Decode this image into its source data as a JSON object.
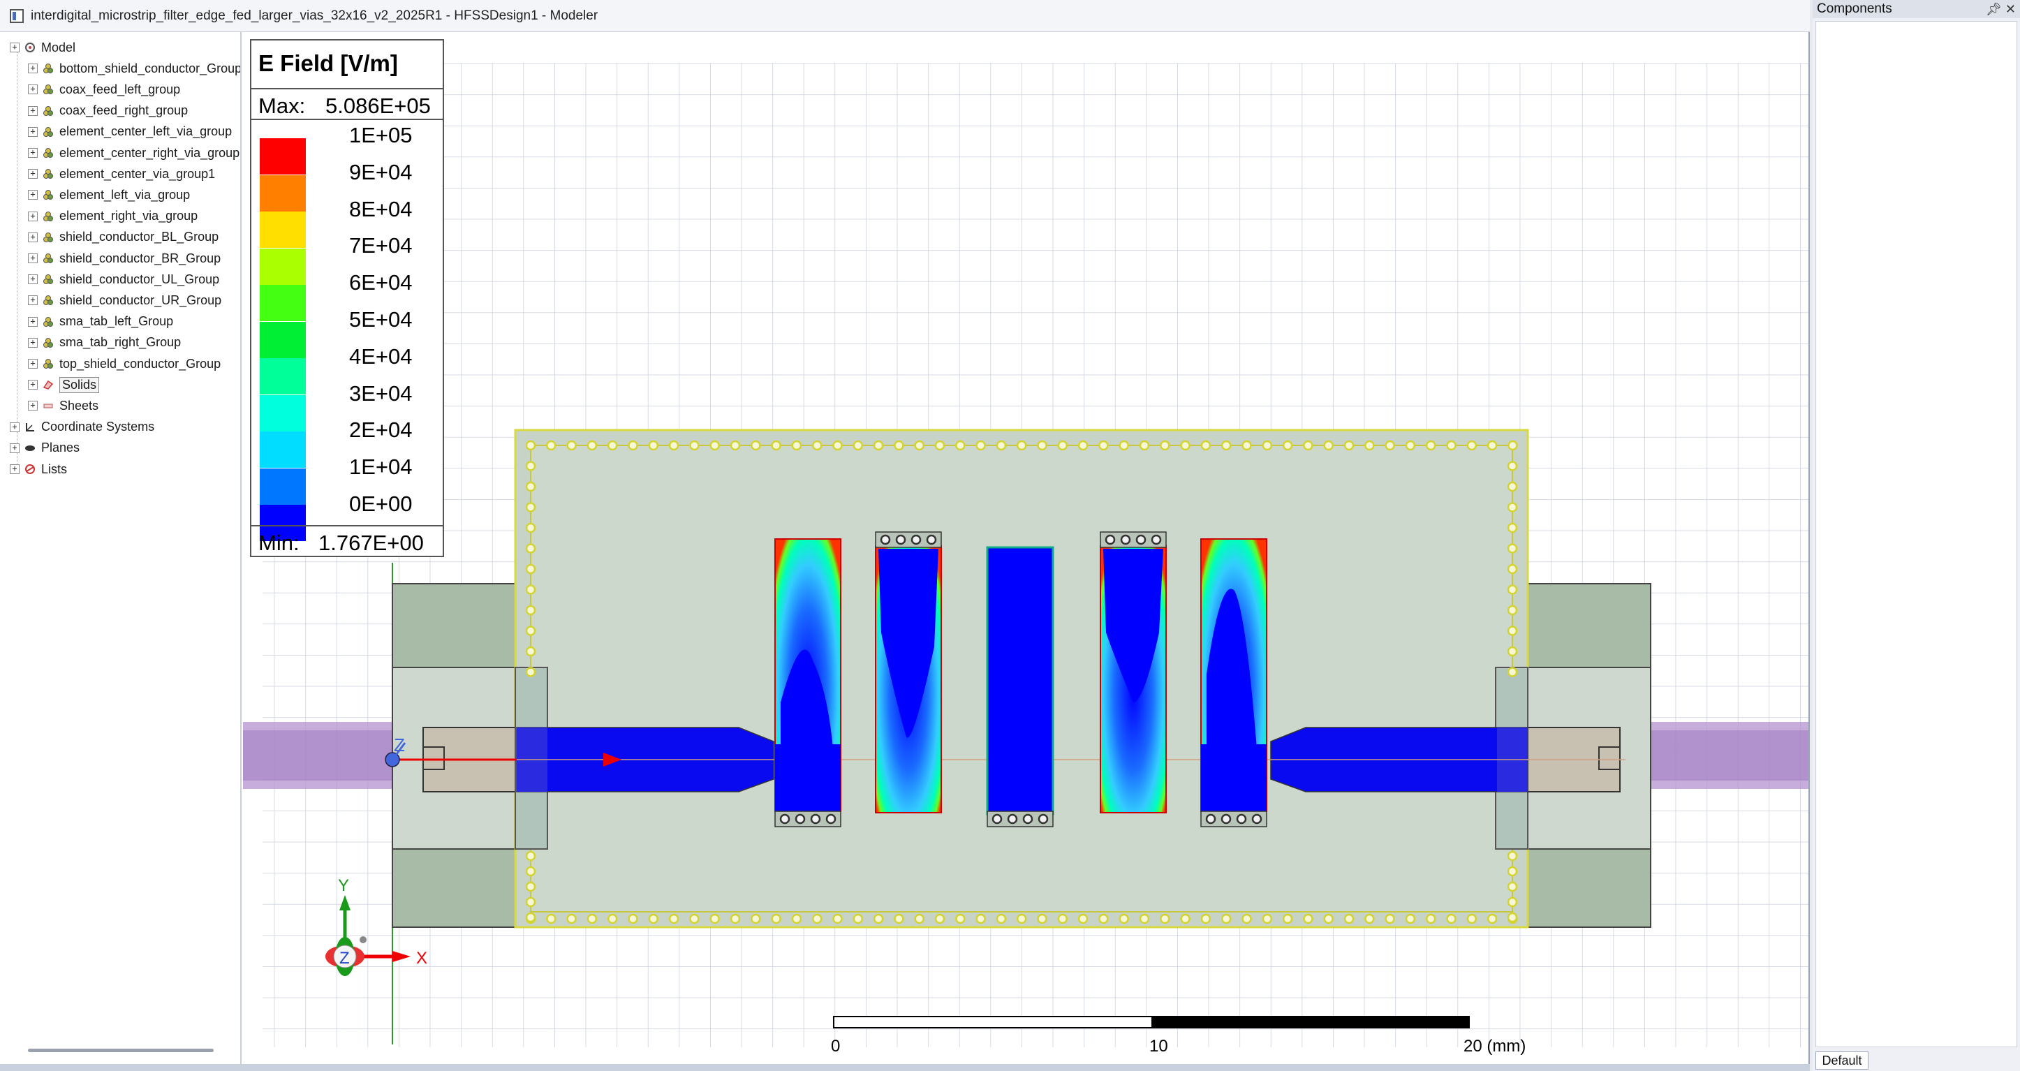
{
  "window": {
    "title": "interdigital_microstrip_filter_edge_fed_larger_vias_32x16_v2_2025R1 - HFSSDesign1 - Modeler"
  },
  "tree": {
    "root": "Model",
    "groups": [
      "bottom_shield_conductor_Group",
      "coax_feed_left_group",
      "coax_feed_right_group",
      "element_center_left_via_group",
      "element_center_right_via_group",
      "element_center_via_group1",
      "element_left_via_group",
      "element_right_via_group",
      "shield_conductor_BL_Group",
      "shield_conductor_BR_Group",
      "shield_conductor_UL_Group",
      "shield_conductor_UR_Group",
      "sma_tab_left_Group",
      "sma_tab_right_Group",
      "top_shield_conductor_Group"
    ],
    "solids": "Solids",
    "sheets": "Sheets",
    "top_level": [
      "Coordinate Systems",
      "Planes",
      "Lists"
    ]
  },
  "legend": {
    "title": "E Field [V/m]",
    "max_label": "Max:",
    "max_value": "5.086E+05",
    "min_label": "Min:",
    "min_value": "1.767E+00",
    "ticks": [
      "1E+05",
      "9E+04",
      "8E+04",
      "7E+04",
      "6E+04",
      "5E+04",
      "4E+04",
      "3E+04",
      "2E+04",
      "1E+04",
      "0E+00"
    ],
    "colors": [
      "#ff0000",
      "#ff7f00",
      "#ffdf00",
      "#aaff00",
      "#44ff11",
      "#00ee33",
      "#00ff99",
      "#00ffdd",
      "#00ddff",
      "#0077ff",
      "#0000ff"
    ]
  },
  "scale": {
    "labels": [
      "0",
      "10",
      "20 (mm)"
    ]
  },
  "axes": {
    "y": "Y",
    "x": "X",
    "z": "Z"
  },
  "components": {
    "header": "Components",
    "pin_icon": "pin-icon",
    "close_icon": "close-icon",
    "tab": "Default"
  }
}
